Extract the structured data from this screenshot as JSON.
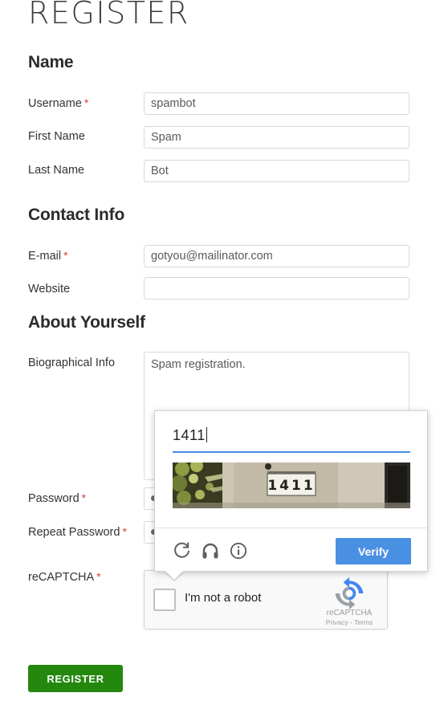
{
  "page": {
    "title": "REGISTER",
    "submit_label": "REGISTER",
    "required_marker": "*"
  },
  "sections": {
    "name": {
      "heading": "Name"
    },
    "contact": {
      "heading": "Contact Info"
    },
    "about": {
      "heading": "About Yourself"
    }
  },
  "fields": {
    "username": {
      "label": "Username",
      "value": "spambot",
      "placeholder": ""
    },
    "first_name": {
      "label": "First Name",
      "value": "Spam",
      "placeholder": ""
    },
    "last_name": {
      "label": "Last Name",
      "value": "Bot",
      "placeholder": ""
    },
    "email": {
      "label": "E-mail",
      "value": "gotyou@mailinator.com",
      "placeholder": ""
    },
    "website": {
      "label": "Website",
      "value": "",
      "placeholder": ""
    },
    "bio": {
      "label": "Biographical Info",
      "value": "Spam registration.",
      "placeholder": ""
    },
    "password": {
      "label": "Password",
      "value": "•",
      "placeholder": ""
    },
    "repeat_password": {
      "label": "Repeat Password",
      "value": "•",
      "placeholder": ""
    },
    "recaptcha": {
      "label": "reCAPTCHA"
    }
  },
  "recaptcha_widget": {
    "checkbox_label": "I'm not a robot",
    "checked": "false",
    "brand_name": "reCAPTCHA",
    "brand_links": "Privacy - Terms",
    "logo_icon": "recaptcha-logo-icon"
  },
  "recaptcha_challenge": {
    "answer_value": "1411",
    "image_alt": "house facade with street number plate 1411",
    "image_number": "1411",
    "verify_label": "Verify",
    "refresh_icon": "refresh-icon",
    "audio_icon": "headphones-icon",
    "info_icon": "info-icon"
  },
  "colors": {
    "submit_green": "#24880f",
    "verify_blue": "#4a90e2",
    "required_red": "#e03b3b",
    "input_border": "#d8d8d8"
  }
}
